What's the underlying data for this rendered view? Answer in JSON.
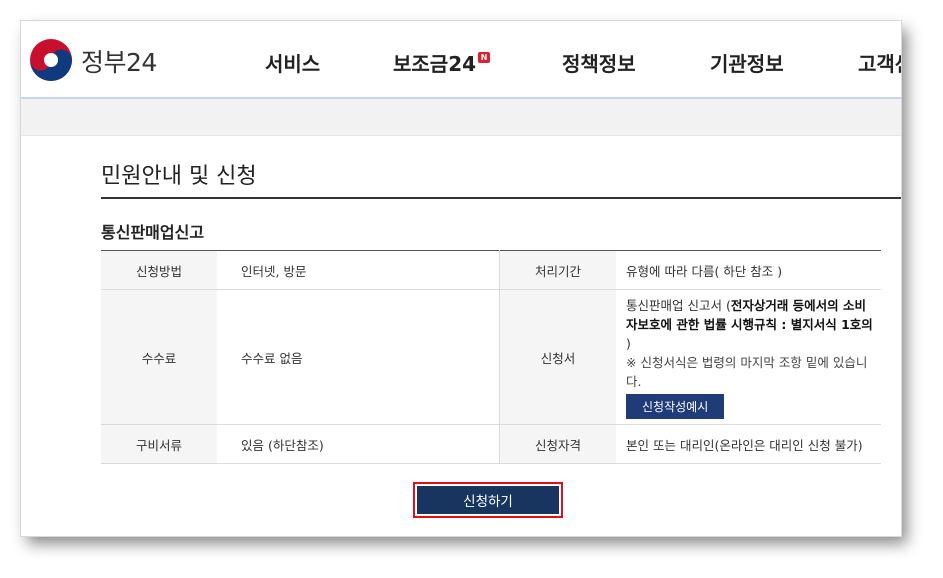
{
  "header": {
    "brand": "정부24",
    "nav": [
      "서비스",
      "보조금24",
      "정책정보",
      "기관정보",
      "고객센터"
    ],
    "badge": "N"
  },
  "page_title": "민원안내 및 신청",
  "service_title": "통신판매업신고",
  "table": {
    "apply_method_label": "신청방법",
    "apply_method_value": "인터넷, 방문",
    "processing_label": "처리기간",
    "processing_value": "유형에 따라 다름( 하단 참조 )",
    "fee_label": "수수료",
    "fee_value": "수수료 없음",
    "form_label": "신청서",
    "form_prefix": "통신판매업 신고서 (",
    "form_bold": "전자상거래 등에서의 소비자보호에 관한 법률 시행규칙 : 별지서식 1호의",
    "form_suffix": " )",
    "form_note": "※ 신청서식은 법령의 마지막 조항 밑에 있습니다.",
    "example_button": "신청작성예시",
    "docs_label": "구비서류",
    "docs_value": "있음 (하단참조)",
    "qualification_label": "신청자격",
    "qualification_value": "본인 또는 대리인(온라인은 대리인 신청 불가)"
  },
  "apply_button": "신청하기",
  "colors": {
    "primary_navy": "#17355f",
    "example_button": "#1f3c78",
    "highlight_border": "#e0101a",
    "logo_red": "#c8102e",
    "logo_blue": "#0f3a7d"
  }
}
